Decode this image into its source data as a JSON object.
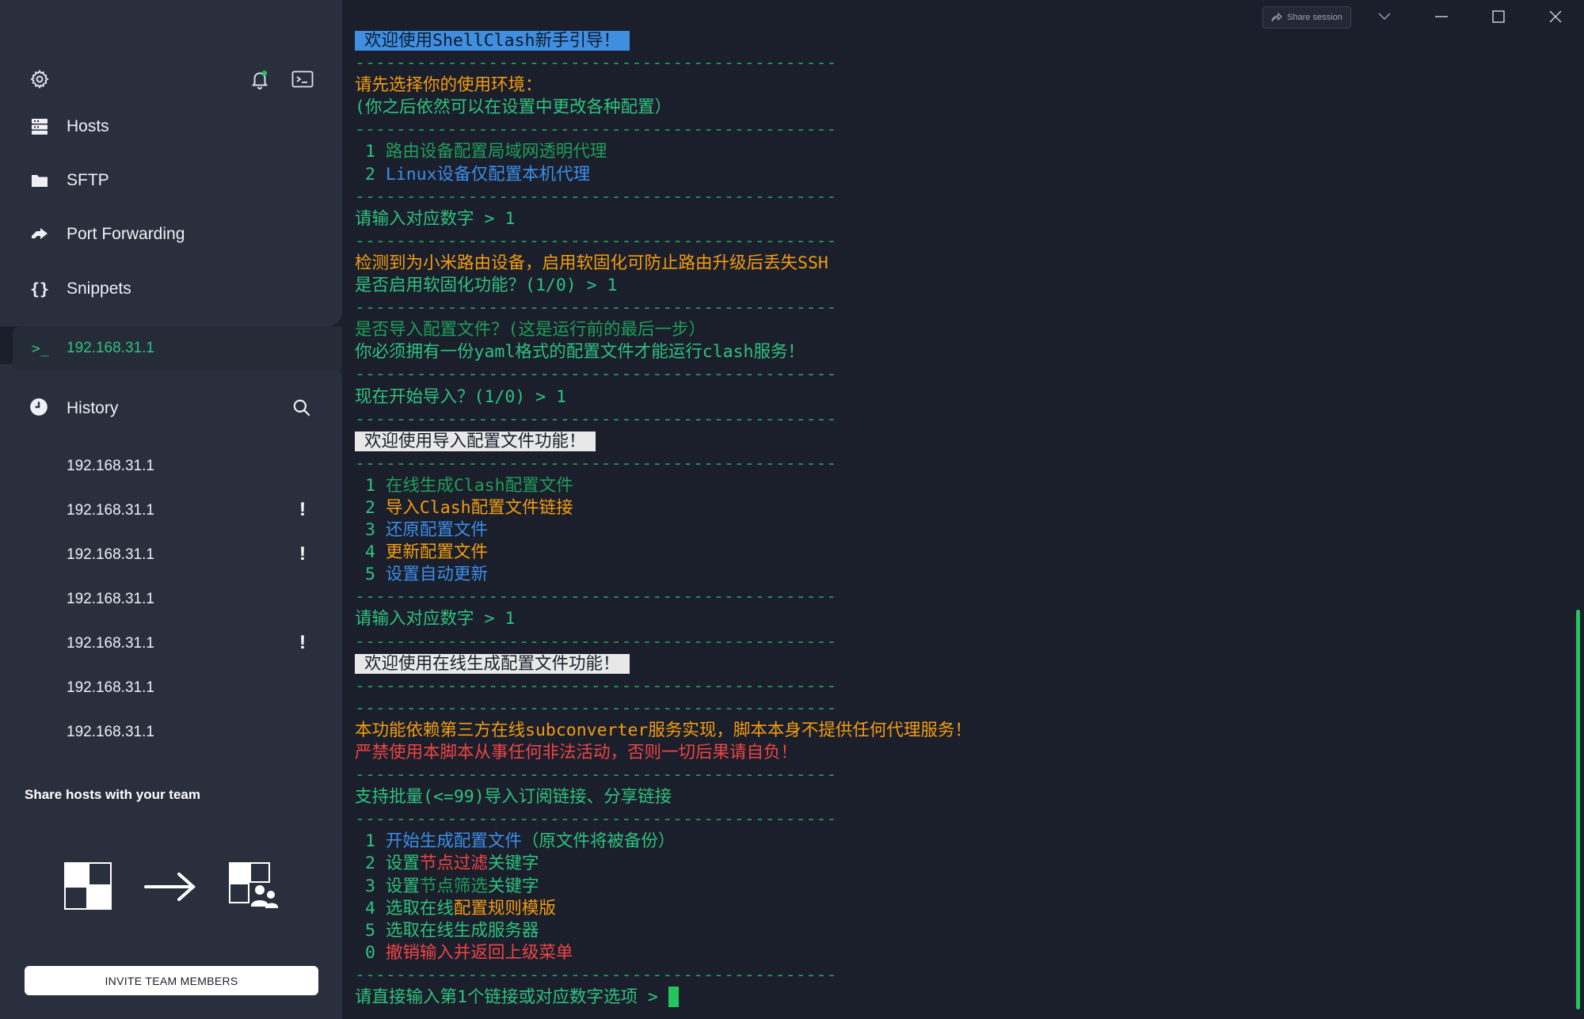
{
  "sidebar": {
    "nav": [
      {
        "icon": "hosts-icon",
        "label": "Hosts"
      },
      {
        "icon": "folder-icon",
        "label": "SFTP"
      },
      {
        "icon": "port-forward-icon",
        "label": "Port Forwarding"
      },
      {
        "icon": "braces-icon",
        "label": "Snippets"
      }
    ],
    "active_session": {
      "prompt": ">_",
      "label": "192.168.31.1"
    },
    "history": {
      "title": "History",
      "items": [
        {
          "label": "192.168.31.1",
          "warning": ""
        },
        {
          "label": "192.168.31.1",
          "warning": "!"
        },
        {
          "label": "192.168.31.1",
          "warning": "!"
        },
        {
          "label": "192.168.31.1",
          "warning": ""
        },
        {
          "label": "192.168.31.1",
          "warning": "!"
        },
        {
          "label": "192.168.31.1",
          "warning": ""
        },
        {
          "label": "192.168.31.1",
          "warning": ""
        }
      ]
    },
    "share_title": "Share hosts with your team",
    "invite_label": "INVITE TEAM MEMBERS"
  },
  "window": {
    "share_session_label": "Share session",
    "accent_color": "#22c55e"
  },
  "terminal": {
    "lines": [
      [
        {
          "t": "欢迎使用ShellClash新手引导！",
          "c": "hl-blue"
        }
      ],
      [
        {
          "t": "-----------------------------------------------",
          "c": "c-dkgreen"
        }
      ],
      [
        {
          "t": "请先选择你的使用环境：",
          "c": "c-orange"
        }
      ],
      [
        {
          "t": "(你之后依然可以在设置中更改各种配置）",
          "c": "c-green"
        }
      ],
      [
        {
          "t": "-----------------------------------------------",
          "c": "c-dkgreen"
        }
      ],
      [
        {
          "t": " 1 ",
          "c": "c-green"
        },
        {
          "t": "路由设备配置局域网透明代理",
          "c": "c-dkgreen"
        }
      ],
      [
        {
          "t": " 2 ",
          "c": "c-green"
        },
        {
          "t": "Linux设备仅配置本机代理",
          "c": "c-blue"
        }
      ],
      [
        {
          "t": "-----------------------------------------------",
          "c": "c-dkgreen"
        }
      ],
      [
        {
          "t": "请输入对应数字 > 1",
          "c": "c-green"
        }
      ],
      [
        {
          "t": "-----------------------------------------------",
          "c": "c-dkgreen"
        }
      ],
      [
        {
          "t": "检测到为小米路由设备，启用软固化可防止路由升级后丢失SSH",
          "c": "c-orange"
        }
      ],
      [
        {
          "t": "是否启用软固化功能？(1/0) > 1",
          "c": "c-green"
        }
      ],
      [
        {
          "t": "-----------------------------------------------",
          "c": "c-dkgreen"
        }
      ],
      [
        {
          "t": "是否导入配置文件？(这是运行前的最后一步）",
          "c": "c-dkgreen"
        }
      ],
      [
        {
          "t": "你必须拥有一份yaml格式的配置文件才能运行clash服务！",
          "c": "c-green"
        }
      ],
      [
        {
          "t": "-----------------------------------------------",
          "c": "c-dkgreen"
        }
      ],
      [
        {
          "t": "现在开始导入？(1/0) > 1",
          "c": "c-green"
        }
      ],
      [
        {
          "t": "-----------------------------------------------",
          "c": "c-dkgreen"
        }
      ],
      [
        {
          "t": "欢迎使用导入配置文件功能！",
          "c": "hl-white"
        }
      ],
      [
        {
          "t": "-----------------------------------------------",
          "c": "c-dkgreen"
        }
      ],
      [
        {
          "t": " 1 ",
          "c": "c-green"
        },
        {
          "t": "在线生成Clash配置文件",
          "c": "c-dkgreen"
        }
      ],
      [
        {
          "t": " 2 ",
          "c": "c-green"
        },
        {
          "t": "导入Clash配置文件链接",
          "c": "c-orange"
        }
      ],
      [
        {
          "t": " 3 ",
          "c": "c-green"
        },
        {
          "t": "还原配置文件",
          "c": "c-blue"
        }
      ],
      [
        {
          "t": " 4 ",
          "c": "c-green"
        },
        {
          "t": "更新配置文件",
          "c": "c-orange"
        }
      ],
      [
        {
          "t": " 5 ",
          "c": "c-green"
        },
        {
          "t": "设置自动更新",
          "c": "c-blue"
        }
      ],
      [
        {
          "t": "-----------------------------------------------",
          "c": "c-dkgreen"
        }
      ],
      [
        {
          "t": "请输入对应数字 > 1",
          "c": "c-green"
        }
      ],
      [
        {
          "t": "-----------------------------------------------",
          "c": "c-dkgreen"
        }
      ],
      [
        {
          "t": "欢迎使用在线生成配置文件功能！",
          "c": "hl-white"
        }
      ],
      [
        {
          "t": "-----------------------------------------------",
          "c": "c-dkgreen"
        }
      ],
      [
        {
          "t": "-----------------------------------------------",
          "c": "c-dkgreen"
        }
      ],
      [
        {
          "t": "本功能依赖第三方在线subconverter服务实现，脚本本身不提供任何代理服务！",
          "c": "c-orange"
        }
      ],
      [
        {
          "t": "严禁使用本脚本从事任何非法活动，否则一切后果请自负！",
          "c": "c-red"
        }
      ],
      [
        {
          "t": "-----------------------------------------------",
          "c": "c-dkgreen"
        }
      ],
      [
        {
          "t": "支持批量(<=99)导入订阅链接、分享链接",
          "c": "c-green"
        }
      ],
      [
        {
          "t": "-----------------------------------------------",
          "c": "c-dkgreen"
        }
      ],
      [
        {
          "t": " 1 ",
          "c": "c-green"
        },
        {
          "t": "开始生成配置文件",
          "c": "c-blue"
        },
        {
          "t": "（原文件将被备份）",
          "c": "c-green"
        }
      ],
      [
        {
          "t": " 2 ",
          "c": "c-green"
        },
        {
          "t": "设置",
          "c": "c-green"
        },
        {
          "t": "节点过滤",
          "c": "c-red"
        },
        {
          "t": "关键字",
          "c": "c-green"
        }
      ],
      [
        {
          "t": " 3 ",
          "c": "c-green"
        },
        {
          "t": "设置",
          "c": "c-green"
        },
        {
          "t": "节点筛选",
          "c": "c-dkgreen"
        },
        {
          "t": "关键字",
          "c": "c-green"
        }
      ],
      [
        {
          "t": " 4 ",
          "c": "c-green"
        },
        {
          "t": "选取在线",
          "c": "c-green"
        },
        {
          "t": "配置规则模版",
          "c": "c-orange"
        }
      ],
      [
        {
          "t": " 5 ",
          "c": "c-green"
        },
        {
          "t": "选取在线生成服务器",
          "c": "c-green"
        }
      ],
      [
        {
          "t": " 0 ",
          "c": "c-green"
        },
        {
          "t": "撤销输入并返回上级菜单",
          "c": "c-red"
        }
      ],
      [
        {
          "t": "-----------------------------------------------",
          "c": "c-dkgreen"
        }
      ],
      [
        {
          "t": "请直接输入第1个链接或对应数字选项 > ",
          "c": "c-green"
        },
        {
          "t": "",
          "c": "cursor"
        }
      ]
    ]
  }
}
